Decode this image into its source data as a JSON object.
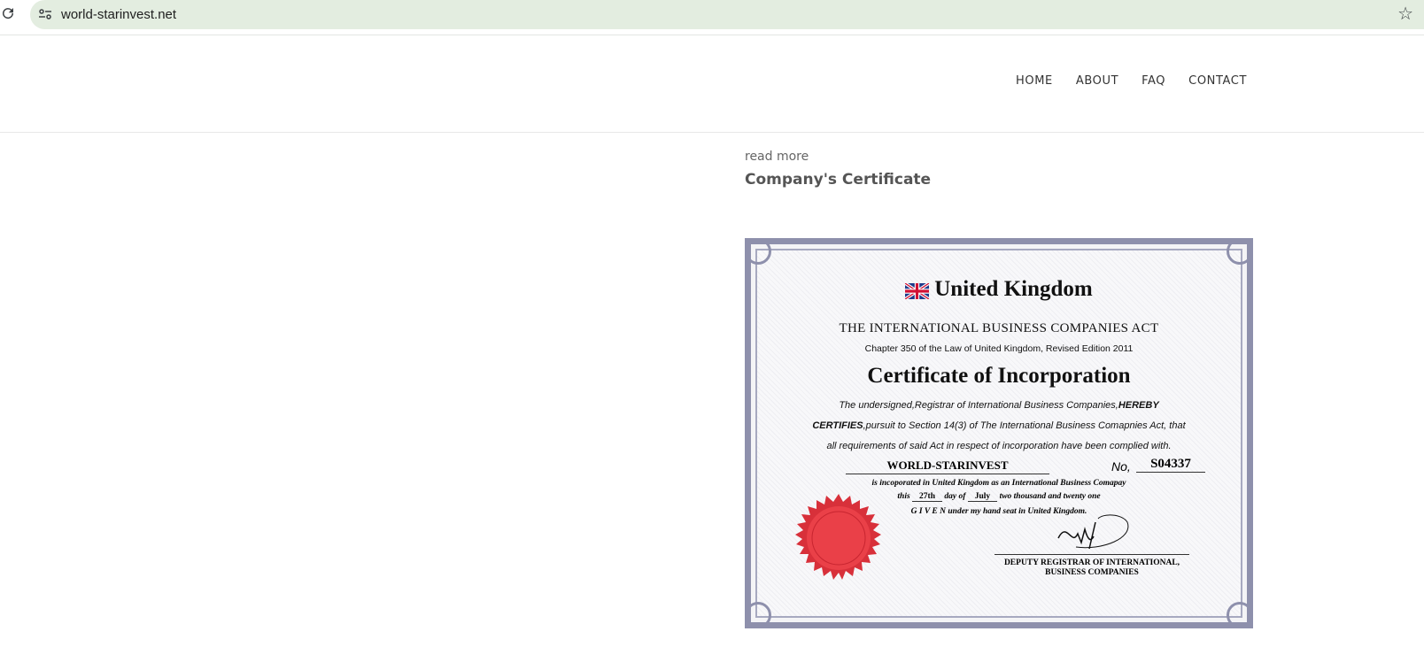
{
  "browser": {
    "url": "world-starinvest.net",
    "icons": {
      "reload": "reload-icon",
      "site_info": "site-info-icon",
      "bookmark": "star-icon"
    }
  },
  "nav": {
    "items": [
      {
        "label": "HOME"
      },
      {
        "label": "ABOUT"
      },
      {
        "label": "FAQ"
      },
      {
        "label": "CONTACT"
      }
    ]
  },
  "content": {
    "read_more": "read more",
    "section_title": "Company's Certificate"
  },
  "certificate": {
    "country": "United Kingdom",
    "act": "THE INTERNATIONAL BUSINESS COMPANIES ACT",
    "chapter": "Chapter 350 of the Law of  United Kingdom, Revised Edition 2011",
    "title": "Certificate of Incorporation",
    "para_start": "The undersigned,Registrar of International Business Companies,",
    "para_hereby": "HEREBY",
    "para_certifies": "CERTIFIES",
    "para_rest": ",pursuit to Section 14(3) of The International Business Comapnies Act, that all requirements of said Act in respect of incorporation have been complied with.",
    "company_name": "WORLD-STARINVEST",
    "number_label": "No,",
    "number": "S04337",
    "incorporated_line": "is incoporated in United Kingdom as an International Business Comapay",
    "this_label": "this",
    "day": "27th",
    "day_of_label": "day of",
    "month": "July",
    "year_text": "two thousand and twenty one",
    "given_line": "G I V E N  under my hand seat in United Kingdom.",
    "deputy_line1": "DEPUTY REGISTRAR OF INTERNATIONAL,",
    "deputy_line2": "BUSINESS COMPANIES",
    "colors": {
      "border": "#8e90ac",
      "seal": "#e0323c"
    }
  }
}
